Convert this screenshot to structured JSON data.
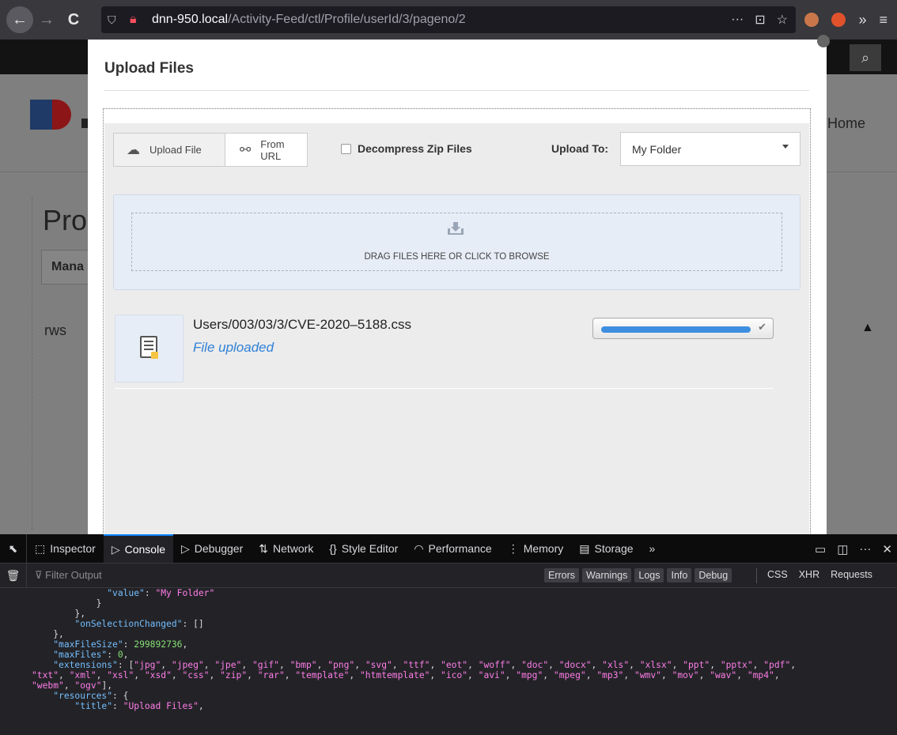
{
  "browser": {
    "url_domain": "dnn-950.local",
    "url_path": "/Activity-Feed/ctl/Profile/userId/3/pageno/2",
    "back_icon": "←",
    "forward_icon": "→",
    "reload_icon": "C",
    "more_icon": "···",
    "overflow_icon": "»",
    "menu_icon": "≡"
  },
  "site": {
    "home_label": "Home",
    "page_title": "Pro",
    "manage_label": "Mana",
    "rws_label": "rws"
  },
  "modal": {
    "title": "Upload Files",
    "upload_file_label": "Upload File",
    "from_url_label": "From URL",
    "decompress_label": "Decompress Zip Files",
    "upload_to_label": "Upload To:",
    "folder_value": "My Folder",
    "drop_text": "DRAG FILES HERE OR CLICK TO BROWSE",
    "file": {
      "name": "Users/003/03/3/CVE-2020–5188.css",
      "status": "File uploaded",
      "progress": 1.0
    }
  },
  "devtools": {
    "tabs": [
      {
        "icon": "⬚",
        "label": "Inspector"
      },
      {
        "icon": "▷",
        "label": "Console"
      },
      {
        "icon": "▷",
        "label": "Debugger"
      },
      {
        "icon": "⇅",
        "label": "Network"
      },
      {
        "icon": "{}",
        "label": "Style Editor"
      },
      {
        "icon": "◠",
        "label": "Performance"
      },
      {
        "icon": "⋮",
        "label": "Memory"
      },
      {
        "icon": "▤",
        "label": "Storage"
      }
    ],
    "filter_placeholder": "Filter Output",
    "filter_buttons": [
      "Errors",
      "Warnings",
      "Logs",
      "Info",
      "Debug"
    ],
    "extra_buttons": [
      "CSS",
      "XHR",
      "Requests"
    ],
    "console_lines": [
      "              \"value\": \"My Folder\"",
      "            }",
      "        },",
      "        \"onSelectionChanged\": []",
      "    },",
      "    \"maxFileSize\": 299892736,",
      "    \"maxFiles\": 0,",
      "    \"extensions\": [\"jpg\", \"jpeg\", \"jpe\", \"gif\", \"bmp\", \"png\", \"svg\", \"ttf\", \"eot\", \"woff\", \"doc\", \"docx\", \"xls\", \"xlsx\", \"ppt\", \"pptx\", \"pdf\",",
      "\"txt\", \"xml\", \"xsl\", \"xsd\", \"css\", \"zip\", \"rar\", \"template\", \"htmtemplate\", \"ico\", \"avi\", \"mpg\", \"mpeg\", \"mp3\", \"wmv\", \"mov\", \"wav\", \"mp4\",",
      "\"webm\", \"ogv\"],",
      "    \"resources\": {",
      "        \"title\": \"Upload Files\","
    ]
  },
  "colors": {
    "accent_blue": "#2f80d6",
    "progress_blue": "#3d8ee0",
    "devtools_active": "#0a84ff"
  }
}
